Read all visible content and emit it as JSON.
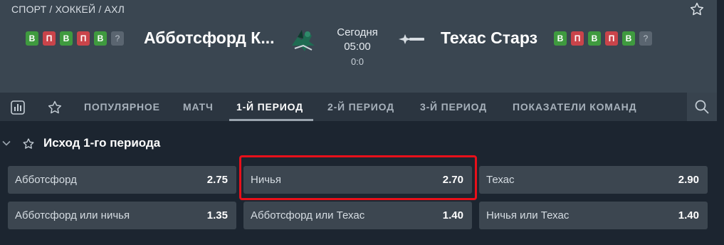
{
  "breadcrumb": "СПОРТ / ХОККЕЙ / АХЛ",
  "match": {
    "home": {
      "name": "Абботсфорд К...",
      "form": [
        {
          "text": "В",
          "kind": "w"
        },
        {
          "text": "П",
          "kind": "l"
        },
        {
          "text": "В",
          "kind": "w"
        },
        {
          "text": "П",
          "kind": "l"
        },
        {
          "text": "В",
          "kind": "w"
        },
        {
          "text": "?",
          "kind": "u"
        }
      ]
    },
    "away": {
      "name": "Техас Старз",
      "form": [
        {
          "text": "В",
          "kind": "w"
        },
        {
          "text": "П",
          "kind": "l"
        },
        {
          "text": "В",
          "kind": "w"
        },
        {
          "text": "П",
          "kind": "l"
        },
        {
          "text": "В",
          "kind": "w"
        },
        {
          "text": "?",
          "kind": "u"
        }
      ]
    },
    "day": "Сегодня",
    "time": "05:00",
    "score": "0:0"
  },
  "tabs": [
    {
      "label": "ПОПУЛЯРНОЕ",
      "active": false
    },
    {
      "label": "МАТЧ",
      "active": false
    },
    {
      "label": "1-Й ПЕРИОД",
      "active": true
    },
    {
      "label": "2-Й ПЕРИОД",
      "active": false
    },
    {
      "label": "3-Й ПЕРИОД",
      "active": false
    },
    {
      "label": "ПОКАЗАТЕЛИ КОМАНД",
      "active": false
    }
  ],
  "market": {
    "title": "Исход 1-го периода",
    "odds": [
      {
        "label": "Абботсфорд",
        "value": "2.75"
      },
      {
        "label": "Ничья",
        "value": "2.70"
      },
      {
        "label": "Техас",
        "value": "2.90"
      },
      {
        "label": "Абботсфорд или ничья",
        "value": "1.35"
      },
      {
        "label": "Абботсфорд или Техас",
        "value": "1.40"
      },
      {
        "label": "Ничья или Техас",
        "value": "1.40"
      }
    ]
  },
  "colors": {
    "win": "#3f9a3f",
    "loss": "#c9444a",
    "unknown": "#5a6570",
    "highlight": "#e8101a"
  },
  "icons": {
    "stats": "stats-icon",
    "favorite": "star-icon",
    "search": "search-icon",
    "collapse": "chevron-down-icon"
  }
}
